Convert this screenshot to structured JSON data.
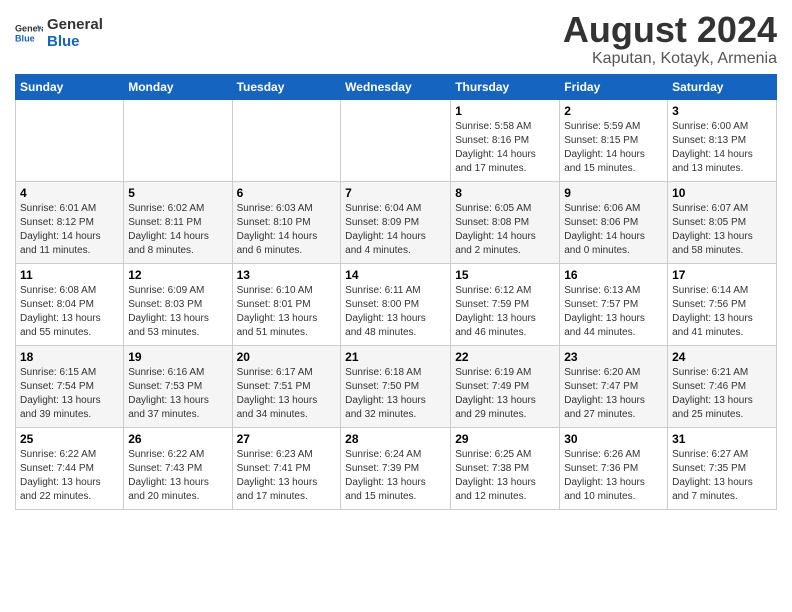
{
  "logo": {
    "line1": "General",
    "line2": "Blue"
  },
  "title": "August 2024",
  "subtitle": "Kaputan, Kotayk, Armenia",
  "days_of_week": [
    "Sunday",
    "Monday",
    "Tuesday",
    "Wednesday",
    "Thursday",
    "Friday",
    "Saturday"
  ],
  "weeks": [
    [
      {
        "day": "",
        "info": ""
      },
      {
        "day": "",
        "info": ""
      },
      {
        "day": "",
        "info": ""
      },
      {
        "day": "",
        "info": ""
      },
      {
        "day": "1",
        "info": "Sunrise: 5:58 AM\nSunset: 8:16 PM\nDaylight: 14 hours\nand 17 minutes."
      },
      {
        "day": "2",
        "info": "Sunrise: 5:59 AM\nSunset: 8:15 PM\nDaylight: 14 hours\nand 15 minutes."
      },
      {
        "day": "3",
        "info": "Sunrise: 6:00 AM\nSunset: 8:13 PM\nDaylight: 14 hours\nand 13 minutes."
      }
    ],
    [
      {
        "day": "4",
        "info": "Sunrise: 6:01 AM\nSunset: 8:12 PM\nDaylight: 14 hours\nand 11 minutes."
      },
      {
        "day": "5",
        "info": "Sunrise: 6:02 AM\nSunset: 8:11 PM\nDaylight: 14 hours\nand 8 minutes."
      },
      {
        "day": "6",
        "info": "Sunrise: 6:03 AM\nSunset: 8:10 PM\nDaylight: 14 hours\nand 6 minutes."
      },
      {
        "day": "7",
        "info": "Sunrise: 6:04 AM\nSunset: 8:09 PM\nDaylight: 14 hours\nand 4 minutes."
      },
      {
        "day": "8",
        "info": "Sunrise: 6:05 AM\nSunset: 8:08 PM\nDaylight: 14 hours\nand 2 minutes."
      },
      {
        "day": "9",
        "info": "Sunrise: 6:06 AM\nSunset: 8:06 PM\nDaylight: 14 hours\nand 0 minutes."
      },
      {
        "day": "10",
        "info": "Sunrise: 6:07 AM\nSunset: 8:05 PM\nDaylight: 13 hours\nand 58 minutes."
      }
    ],
    [
      {
        "day": "11",
        "info": "Sunrise: 6:08 AM\nSunset: 8:04 PM\nDaylight: 13 hours\nand 55 minutes."
      },
      {
        "day": "12",
        "info": "Sunrise: 6:09 AM\nSunset: 8:03 PM\nDaylight: 13 hours\nand 53 minutes."
      },
      {
        "day": "13",
        "info": "Sunrise: 6:10 AM\nSunset: 8:01 PM\nDaylight: 13 hours\nand 51 minutes."
      },
      {
        "day": "14",
        "info": "Sunrise: 6:11 AM\nSunset: 8:00 PM\nDaylight: 13 hours\nand 48 minutes."
      },
      {
        "day": "15",
        "info": "Sunrise: 6:12 AM\nSunset: 7:59 PM\nDaylight: 13 hours\nand 46 minutes."
      },
      {
        "day": "16",
        "info": "Sunrise: 6:13 AM\nSunset: 7:57 PM\nDaylight: 13 hours\nand 44 minutes."
      },
      {
        "day": "17",
        "info": "Sunrise: 6:14 AM\nSunset: 7:56 PM\nDaylight: 13 hours\nand 41 minutes."
      }
    ],
    [
      {
        "day": "18",
        "info": "Sunrise: 6:15 AM\nSunset: 7:54 PM\nDaylight: 13 hours\nand 39 minutes."
      },
      {
        "day": "19",
        "info": "Sunrise: 6:16 AM\nSunset: 7:53 PM\nDaylight: 13 hours\nand 37 minutes."
      },
      {
        "day": "20",
        "info": "Sunrise: 6:17 AM\nSunset: 7:51 PM\nDaylight: 13 hours\nand 34 minutes."
      },
      {
        "day": "21",
        "info": "Sunrise: 6:18 AM\nSunset: 7:50 PM\nDaylight: 13 hours\nand 32 minutes."
      },
      {
        "day": "22",
        "info": "Sunrise: 6:19 AM\nSunset: 7:49 PM\nDaylight: 13 hours\nand 29 minutes."
      },
      {
        "day": "23",
        "info": "Sunrise: 6:20 AM\nSunset: 7:47 PM\nDaylight: 13 hours\nand 27 minutes."
      },
      {
        "day": "24",
        "info": "Sunrise: 6:21 AM\nSunset: 7:46 PM\nDaylight: 13 hours\nand 25 minutes."
      }
    ],
    [
      {
        "day": "25",
        "info": "Sunrise: 6:22 AM\nSunset: 7:44 PM\nDaylight: 13 hours\nand 22 minutes."
      },
      {
        "day": "26",
        "info": "Sunrise: 6:22 AM\nSunset: 7:43 PM\nDaylight: 13 hours\nand 20 minutes."
      },
      {
        "day": "27",
        "info": "Sunrise: 6:23 AM\nSunset: 7:41 PM\nDaylight: 13 hours\nand 17 minutes."
      },
      {
        "day": "28",
        "info": "Sunrise: 6:24 AM\nSunset: 7:39 PM\nDaylight: 13 hours\nand 15 minutes."
      },
      {
        "day": "29",
        "info": "Sunrise: 6:25 AM\nSunset: 7:38 PM\nDaylight: 13 hours\nand 12 minutes."
      },
      {
        "day": "30",
        "info": "Sunrise: 6:26 AM\nSunset: 7:36 PM\nDaylight: 13 hours\nand 10 minutes."
      },
      {
        "day": "31",
        "info": "Sunrise: 6:27 AM\nSunset: 7:35 PM\nDaylight: 13 hours\nand 7 minutes."
      }
    ]
  ]
}
